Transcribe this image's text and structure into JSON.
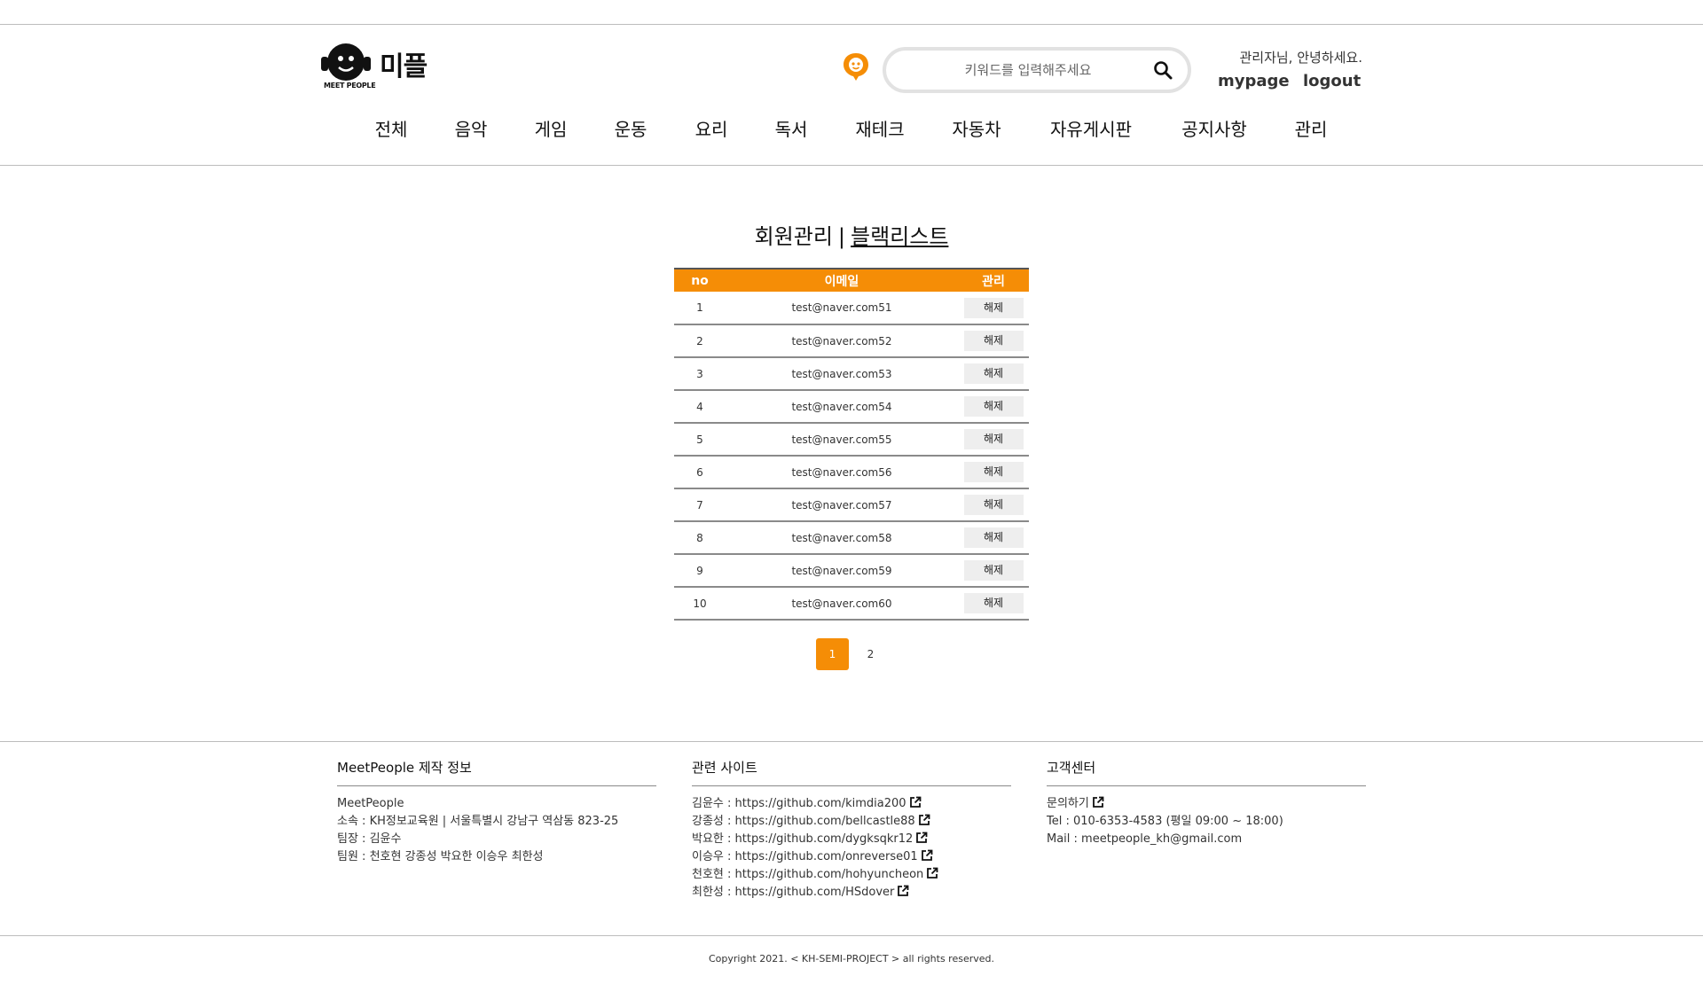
{
  "header": {
    "logo_text": "미플",
    "logo_sub": "MEET PEOPLE",
    "search_placeholder": "키워드를 입력해주세요",
    "greeting": "관리자님, 안녕하세요.",
    "mypage_label": "mypage",
    "logout_label": "logout"
  },
  "nav": [
    "전체",
    "음악",
    "게임",
    "운동",
    "요리",
    "독서",
    "재테크",
    "자동차",
    "자유게시판",
    "공지사항",
    "관리"
  ],
  "main": {
    "heading_main": "회원관리",
    "heading_sep": "|",
    "heading_sub": "블랙리스트",
    "table_headers": [
      "no",
      "이메일",
      "관리"
    ],
    "release_label": "해제",
    "rows": [
      {
        "no": "1",
        "email": "test@naver.com51"
      },
      {
        "no": "2",
        "email": "test@naver.com52"
      },
      {
        "no": "3",
        "email": "test@naver.com53"
      },
      {
        "no": "4",
        "email": "test@naver.com54"
      },
      {
        "no": "5",
        "email": "test@naver.com55"
      },
      {
        "no": "6",
        "email": "test@naver.com56"
      },
      {
        "no": "7",
        "email": "test@naver.com57"
      },
      {
        "no": "8",
        "email": "test@naver.com58"
      },
      {
        "no": "9",
        "email": "test@naver.com59"
      },
      {
        "no": "10",
        "email": "test@naver.com60"
      }
    ],
    "pages": [
      "1",
      "2"
    ],
    "current_page": "1"
  },
  "footer": {
    "info_title": "MeetPeople 제작 정보",
    "info_lines": [
      "MeetPeople",
      "소속 : KH정보교육원 | 서울특별시 강남구 역삼동 823-25",
      "팀장 : 김윤수",
      "팀원 : 천호현 강종성 박요한 이승우 최한성"
    ],
    "sites_title": "관련 사이트",
    "sites": [
      "김윤수 : https://github.com/kimdia200",
      "강종성 : https://github.com/bellcastle88",
      "박요한 : https://github.com/dygksqkr12",
      "이승우 : https://github.com/onreverse01",
      "천호현 : https://github.com/hohyuncheon",
      "최한성 : https://github.com/HSdover"
    ],
    "cs_title": "고객센터",
    "cs_inquiry": "문의하기",
    "cs_tel": "Tel : 010-6353-4583 (평일 09:00 ~ 18:00)",
    "cs_mail": "Mail : meetpeople_kh@gmail.com",
    "copyright": "Copyright 2021. < KH-SEMI-PROJECT > all rights reserved."
  },
  "colors": {
    "accent": "#f58d06",
    "button_bg": "#eeeeee",
    "rule": "#bdbdbd"
  },
  "icons": [
    "headset-logo-icon",
    "chat-face-icon",
    "search-icon",
    "external-link-icon"
  ]
}
